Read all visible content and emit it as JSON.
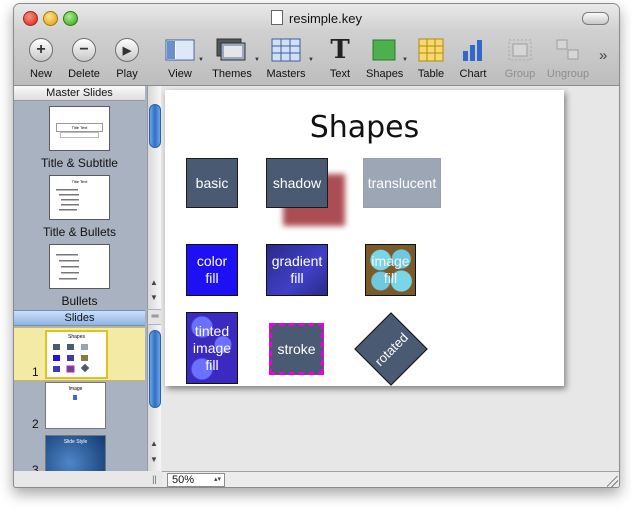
{
  "window": {
    "title": "resimple.key"
  },
  "toolbar": {
    "new": "New",
    "delete": "Delete",
    "play": "Play",
    "view": "View",
    "themes": "Themes",
    "masters": "Masters",
    "text": "Text",
    "text_glyph": "T",
    "shapes": "Shapes",
    "table": "Table",
    "chart": "Chart",
    "group": "Group",
    "ungroup": "Ungroup",
    "overflow": "»"
  },
  "sidebar": {
    "master_header": "Master Slides",
    "masters": [
      {
        "label": "Title & Subtitle",
        "thumb_text": "Title Text"
      },
      {
        "label": "Title & Bullets",
        "thumb_text": "Title Text"
      },
      {
        "label": "Bullets",
        "thumb_text": ""
      }
    ],
    "slides_header": "Slides",
    "slides": [
      {
        "number": "1",
        "thumb_text": "Shapes"
      },
      {
        "number": "2",
        "thumb_text": "Image"
      },
      {
        "number": "3",
        "thumb_text": "Slide Style"
      }
    ]
  },
  "slide": {
    "title": "Shapes",
    "shapes": [
      {
        "text": "basic"
      },
      {
        "text": "shadow"
      },
      {
        "text": "translucent"
      },
      {
        "text": "color fill"
      },
      {
        "text": "gradient fill"
      },
      {
        "text": "image fill"
      },
      {
        "text": "tinted image fill"
      },
      {
        "text": "stroke"
      },
      {
        "text": "rotated"
      }
    ]
  },
  "status": {
    "zoom": "50%"
  },
  "colors": {
    "shape_slate": "#4a5a72",
    "color_fill": "#1e10f5",
    "stroke_magenta": "#ee00dd",
    "shadow_red": "#a33a40",
    "selection": "#f0e070"
  }
}
